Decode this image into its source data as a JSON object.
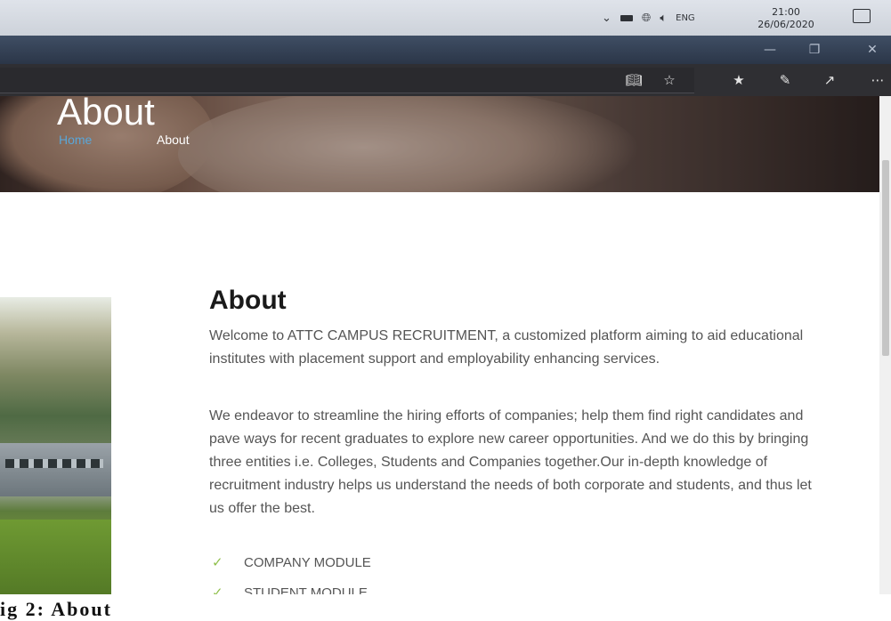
{
  "taskbar": {
    "tray_icons": {
      "chevron": "chevron-up-icon",
      "battery": "battery-icon",
      "network": "globe-network-icon",
      "volume": "speaker-icon"
    },
    "language": "ENG",
    "time": "21:00",
    "date": "26/06/2020",
    "notification_icon": "notification-icon"
  },
  "browser": {
    "window_buttons": [
      "minimize-icon",
      "restore-icon",
      "close-icon"
    ],
    "toolbar_icons": [
      "reading-view-icon",
      "favorite-star-icon",
      "favorites-list-icon",
      "pen-icon",
      "share-icon",
      "more-icon"
    ]
  },
  "page": {
    "hero": {
      "title": "About",
      "breadcrumb_home": "Home",
      "breadcrumb_current": "About"
    },
    "about": {
      "heading": "About",
      "paragraph1": "Welcome to ATTC CAMPUS RECRUITMENT, a customized platform aiming to aid educational institutes with placement support and employability enhancing services.",
      "paragraph2": "We endeavor to streamline the hiring efforts of companies; help them find right candidates and pave ways for recent graduates to explore new career opportunities. And we do this by bringing three entities i.e. Colleges, Students and Companies together.Our in-depth knowledge of recruitment industry helps us understand the needs of both corporate and students, and thus let us offer the best.",
      "modules": [
        "COMPANY MODULE",
        "STUDENT MODULE"
      ]
    }
  },
  "caption": "ig 2: About"
}
